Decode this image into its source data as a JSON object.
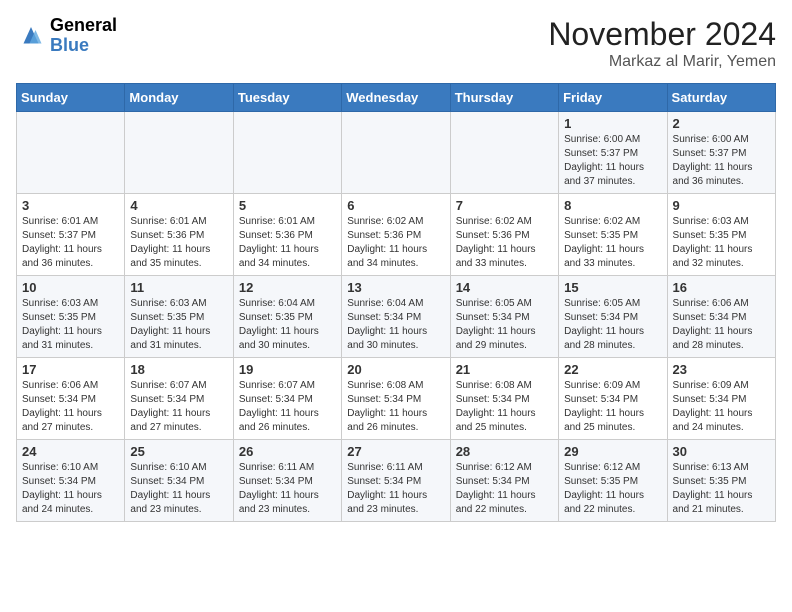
{
  "header": {
    "logo_general": "General",
    "logo_blue": "Blue",
    "month": "November 2024",
    "location": "Markaz al Marir, Yemen"
  },
  "weekdays": [
    "Sunday",
    "Monday",
    "Tuesday",
    "Wednesday",
    "Thursday",
    "Friday",
    "Saturday"
  ],
  "weeks": [
    [
      {
        "day": "",
        "info": ""
      },
      {
        "day": "",
        "info": ""
      },
      {
        "day": "",
        "info": ""
      },
      {
        "day": "",
        "info": ""
      },
      {
        "day": "",
        "info": ""
      },
      {
        "day": "1",
        "info": "Sunrise: 6:00 AM\nSunset: 5:37 PM\nDaylight: 11 hours\nand 37 minutes."
      },
      {
        "day": "2",
        "info": "Sunrise: 6:00 AM\nSunset: 5:37 PM\nDaylight: 11 hours\nand 36 minutes."
      }
    ],
    [
      {
        "day": "3",
        "info": "Sunrise: 6:01 AM\nSunset: 5:37 PM\nDaylight: 11 hours\nand 36 minutes."
      },
      {
        "day": "4",
        "info": "Sunrise: 6:01 AM\nSunset: 5:36 PM\nDaylight: 11 hours\nand 35 minutes."
      },
      {
        "day": "5",
        "info": "Sunrise: 6:01 AM\nSunset: 5:36 PM\nDaylight: 11 hours\nand 34 minutes."
      },
      {
        "day": "6",
        "info": "Sunrise: 6:02 AM\nSunset: 5:36 PM\nDaylight: 11 hours\nand 34 minutes."
      },
      {
        "day": "7",
        "info": "Sunrise: 6:02 AM\nSunset: 5:36 PM\nDaylight: 11 hours\nand 33 minutes."
      },
      {
        "day": "8",
        "info": "Sunrise: 6:02 AM\nSunset: 5:35 PM\nDaylight: 11 hours\nand 33 minutes."
      },
      {
        "day": "9",
        "info": "Sunrise: 6:03 AM\nSunset: 5:35 PM\nDaylight: 11 hours\nand 32 minutes."
      }
    ],
    [
      {
        "day": "10",
        "info": "Sunrise: 6:03 AM\nSunset: 5:35 PM\nDaylight: 11 hours\nand 31 minutes."
      },
      {
        "day": "11",
        "info": "Sunrise: 6:03 AM\nSunset: 5:35 PM\nDaylight: 11 hours\nand 31 minutes."
      },
      {
        "day": "12",
        "info": "Sunrise: 6:04 AM\nSunset: 5:35 PM\nDaylight: 11 hours\nand 30 minutes."
      },
      {
        "day": "13",
        "info": "Sunrise: 6:04 AM\nSunset: 5:34 PM\nDaylight: 11 hours\nand 30 minutes."
      },
      {
        "day": "14",
        "info": "Sunrise: 6:05 AM\nSunset: 5:34 PM\nDaylight: 11 hours\nand 29 minutes."
      },
      {
        "day": "15",
        "info": "Sunrise: 6:05 AM\nSunset: 5:34 PM\nDaylight: 11 hours\nand 28 minutes."
      },
      {
        "day": "16",
        "info": "Sunrise: 6:06 AM\nSunset: 5:34 PM\nDaylight: 11 hours\nand 28 minutes."
      }
    ],
    [
      {
        "day": "17",
        "info": "Sunrise: 6:06 AM\nSunset: 5:34 PM\nDaylight: 11 hours\nand 27 minutes."
      },
      {
        "day": "18",
        "info": "Sunrise: 6:07 AM\nSunset: 5:34 PM\nDaylight: 11 hours\nand 27 minutes."
      },
      {
        "day": "19",
        "info": "Sunrise: 6:07 AM\nSunset: 5:34 PM\nDaylight: 11 hours\nand 26 minutes."
      },
      {
        "day": "20",
        "info": "Sunrise: 6:08 AM\nSunset: 5:34 PM\nDaylight: 11 hours\nand 26 minutes."
      },
      {
        "day": "21",
        "info": "Sunrise: 6:08 AM\nSunset: 5:34 PM\nDaylight: 11 hours\nand 25 minutes."
      },
      {
        "day": "22",
        "info": "Sunrise: 6:09 AM\nSunset: 5:34 PM\nDaylight: 11 hours\nand 25 minutes."
      },
      {
        "day": "23",
        "info": "Sunrise: 6:09 AM\nSunset: 5:34 PM\nDaylight: 11 hours\nand 24 minutes."
      }
    ],
    [
      {
        "day": "24",
        "info": "Sunrise: 6:10 AM\nSunset: 5:34 PM\nDaylight: 11 hours\nand 24 minutes."
      },
      {
        "day": "25",
        "info": "Sunrise: 6:10 AM\nSunset: 5:34 PM\nDaylight: 11 hours\nand 23 minutes."
      },
      {
        "day": "26",
        "info": "Sunrise: 6:11 AM\nSunset: 5:34 PM\nDaylight: 11 hours\nand 23 minutes."
      },
      {
        "day": "27",
        "info": "Sunrise: 6:11 AM\nSunset: 5:34 PM\nDaylight: 11 hours\nand 23 minutes."
      },
      {
        "day": "28",
        "info": "Sunrise: 6:12 AM\nSunset: 5:34 PM\nDaylight: 11 hours\nand 22 minutes."
      },
      {
        "day": "29",
        "info": "Sunrise: 6:12 AM\nSunset: 5:35 PM\nDaylight: 11 hours\nand 22 minutes."
      },
      {
        "day": "30",
        "info": "Sunrise: 6:13 AM\nSunset: 5:35 PM\nDaylight: 11 hours\nand 21 minutes."
      }
    ]
  ]
}
